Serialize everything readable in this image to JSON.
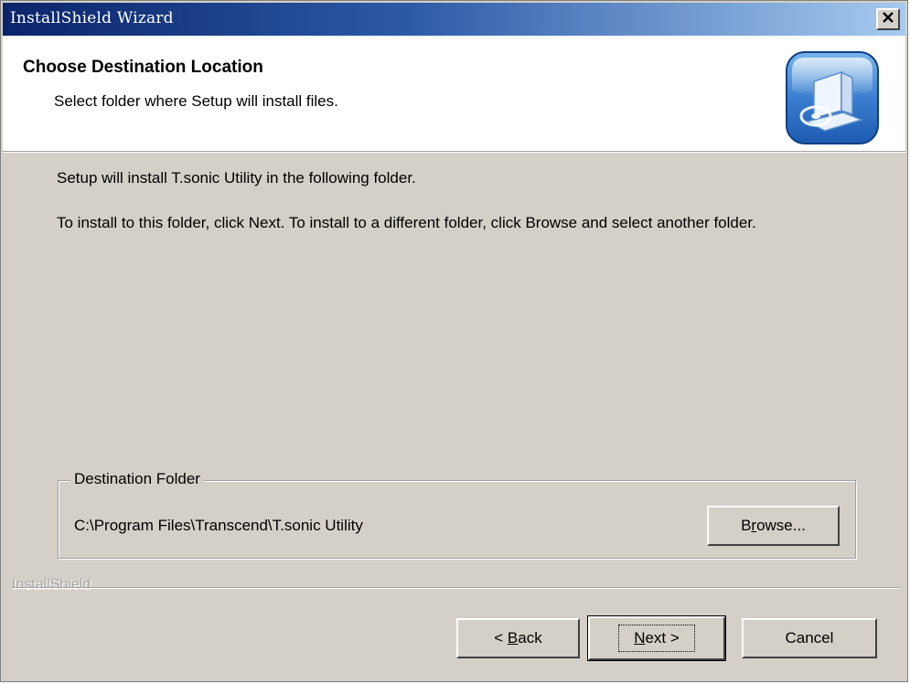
{
  "window": {
    "title": "InstallShield Wizard",
    "close_label": "X"
  },
  "header": {
    "title": "Choose Destination Location",
    "subtitle": "Select folder where Setup will install files.",
    "icon": "computer-cd-icon"
  },
  "body": {
    "intro": "Setup will install T.sonic Utility in the following folder.",
    "instructions": "To install to this folder, click Next. To install to a different folder, click Browse and select another folder."
  },
  "destination": {
    "legend": "Destination Folder",
    "path": "C:\\Program Files\\Transcend\\T.sonic Utility",
    "browse_pre": "B",
    "browse_accel": "r",
    "browse_post": "owse..."
  },
  "footer": {
    "brand": "InstallShield",
    "back_pre": "< ",
    "back_accel": "B",
    "back_post": "ack",
    "next_accel": "N",
    "next_post": "ext >",
    "cancel_label": "Cancel"
  },
  "colors": {
    "title_gradient_start": "#0a246a",
    "title_gradient_end": "#a6caf0",
    "dialog_face": "#d4d0c8"
  }
}
